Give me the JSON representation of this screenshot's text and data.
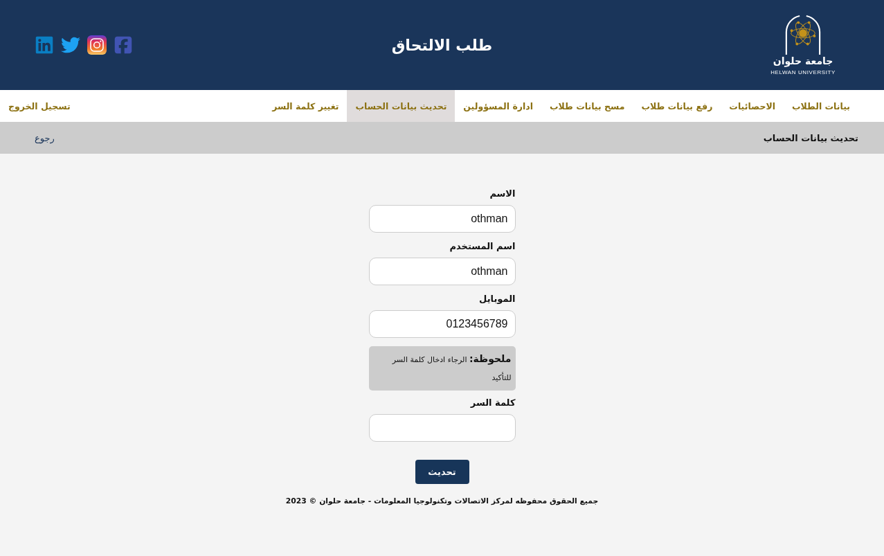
{
  "header": {
    "title": "طلب الالتحاق",
    "logo": {
      "name_ar": "جامعة حلوان",
      "name_en": "HELWAN UNIVERSITY"
    }
  },
  "nav": {
    "items": [
      {
        "label": "بيانات الطلاب",
        "selected": false
      },
      {
        "label": "الاحصائيات",
        "selected": false
      },
      {
        "label": "رفع بيانات طلاب",
        "selected": false
      },
      {
        "label": "مسح بيانات طلاب",
        "selected": false
      },
      {
        "label": "ادارة المسؤولين",
        "selected": false
      },
      {
        "label": "تحديث بيانات الحساب",
        "selected": true
      },
      {
        "label": "تغيير كلمة السر",
        "selected": false
      }
    ],
    "logout": "تسجيل الخروج"
  },
  "page_bar": {
    "title": "تحديث بيانات الحساب",
    "back_link": "رجوع"
  },
  "form": {
    "fields": [
      {
        "label": "الاسم",
        "value": "othman"
      },
      {
        "label": "اسم المستخدم",
        "value": "othman"
      },
      {
        "label": "الموبايل",
        "value": "0123456789"
      }
    ],
    "note": "**ملحوظة:** الرجاء ادخال كلمة السر للتأكيد",
    "password": {
      "label": "كلمة السر"
    },
    "submit": "تحديث"
  },
  "footer": {
    "copyright": "جميع الحقوق محفوظه لمركز الاتصالات وتكنولوجيا المعلومات - جامعة حلوان © 2023"
  }
}
